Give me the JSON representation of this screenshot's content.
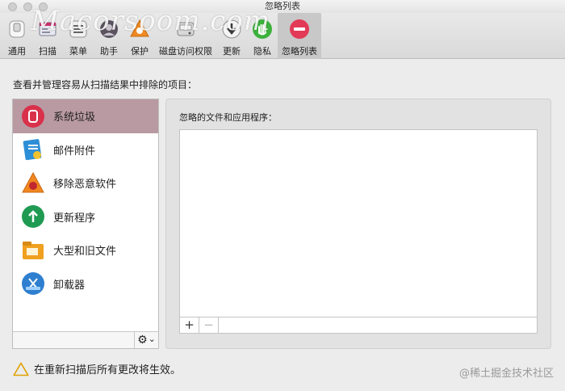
{
  "window": {
    "title": "忽略列表",
    "watermark": "Macorsoom.com"
  },
  "toolbar": {
    "items": [
      {
        "label": "通用",
        "icon": "general-switch-icon"
      },
      {
        "label": "扫描",
        "icon": "scan-icon"
      },
      {
        "label": "菜单",
        "icon": "menu-icon"
      },
      {
        "label": "助手",
        "icon": "assistant-icon"
      },
      {
        "label": "保护",
        "icon": "protection-icon"
      },
      {
        "label": "磁盘访问权限",
        "icon": "disk-access-icon"
      },
      {
        "label": "更新",
        "icon": "update-icon"
      },
      {
        "label": "隐私",
        "icon": "privacy-hand-icon"
      },
      {
        "label": "忽略列表",
        "icon": "ignore-list-icon",
        "selected": true
      }
    ]
  },
  "description": "查看并管理容易从扫描结果中排除的项目：",
  "sidebar": {
    "items": [
      {
        "label": "系统垃圾",
        "icon": "system-junk-icon",
        "selected": true
      },
      {
        "label": "邮件附件",
        "icon": "mail-attachments-icon"
      },
      {
        "label": "移除恶意软件",
        "icon": "malware-removal-icon"
      },
      {
        "label": "更新程序",
        "icon": "updater-icon"
      },
      {
        "label": "大型和旧文件",
        "icon": "large-old-files-icon"
      },
      {
        "label": "卸载器",
        "icon": "uninstaller-icon"
      }
    ],
    "gear_glyph": "⚙",
    "gear_caret": "⌄"
  },
  "panel": {
    "title": "忽略的文件和应用程序：",
    "add_label": "+",
    "remove_label": "−"
  },
  "footer": {
    "notice": "在重新扫描后所有更改将生效。",
    "credit": "@稀土掘金技术社区"
  },
  "colors": {
    "selected_sidebar": "#b99aa2",
    "privacy_green": "#3db13d",
    "ignore_red": "#e23a57"
  }
}
